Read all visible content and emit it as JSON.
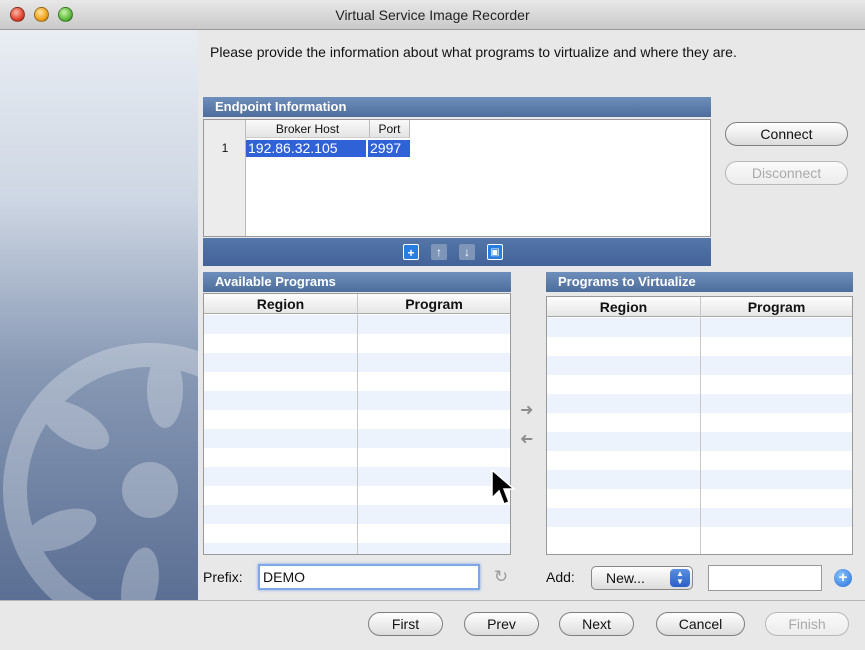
{
  "window": {
    "title": "Virtual Service Image Recorder"
  },
  "instructions": "Please provide the information about what programs to virtualize and where they are.",
  "endpoint": {
    "header": "Endpoint Information",
    "columns": [
      "Broker Host",
      "Port"
    ],
    "rows": [
      {
        "num": "1",
        "broker_host": "192.86.32.105",
        "port": "2997"
      }
    ],
    "connect_label": "Connect",
    "disconnect_label": "Disconnect",
    "toolbar_icons": [
      "add-icon",
      "move-up-icon",
      "move-down-icon",
      "delete-icon"
    ]
  },
  "available_programs": {
    "header": "Available Programs",
    "columns": [
      "Region",
      "Program"
    ]
  },
  "programs_to_virtualize": {
    "header": "Programs to Virtualize",
    "columns": [
      "Region",
      "Program"
    ]
  },
  "prefix": {
    "label": "Prefix:",
    "value": "DEMO"
  },
  "add": {
    "label": "Add:",
    "select_value": "New...",
    "input_value": ""
  },
  "nav_buttons": {
    "first": "First",
    "prev": "Prev",
    "next": "Next",
    "cancel": "Cancel",
    "finish": "Finish"
  },
  "colors": {
    "section_header": "#4d6d9c",
    "selection": "#2f62d6",
    "stripe": "#edf3fd"
  }
}
